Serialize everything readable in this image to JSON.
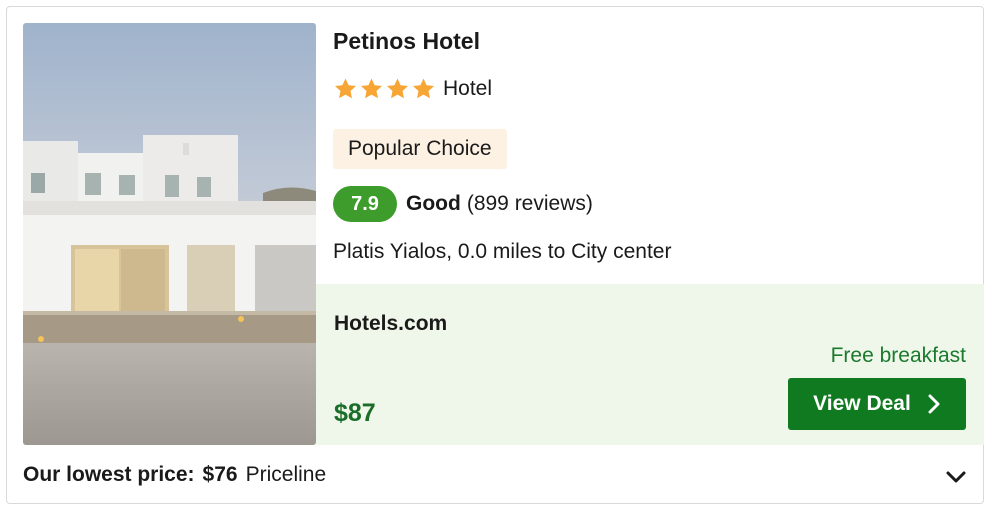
{
  "hotel": {
    "name": "Petinos Hotel",
    "star_rating": 4,
    "type": "Hotel",
    "badge": "Popular Choice",
    "score": "7.9",
    "rating_word": "Good",
    "reviews": "(899 reviews)",
    "location": "Platis Yialos, 0.0 miles to City center",
    "photo_icon": "hotel-photo"
  },
  "deal": {
    "provider": "Hotels.com",
    "perk": "Free breakfast",
    "price": "$87",
    "button_label": "View Deal",
    "button_icon": "chevron-right-icon"
  },
  "footer": {
    "lowest_label": "Our lowest price:",
    "lowest_price": "$76",
    "lowest_provider": "Priceline",
    "expand_icon": "chevron-down-icon"
  },
  "colors": {
    "score_badge": "#3d9c2b",
    "star": "#f7a534",
    "deal_bg": "#eff6ea",
    "button": "#0f7a1f",
    "price": "#1b6e2a",
    "perk": "#1b7a2e",
    "popular_bg": "#fdf1e4"
  }
}
